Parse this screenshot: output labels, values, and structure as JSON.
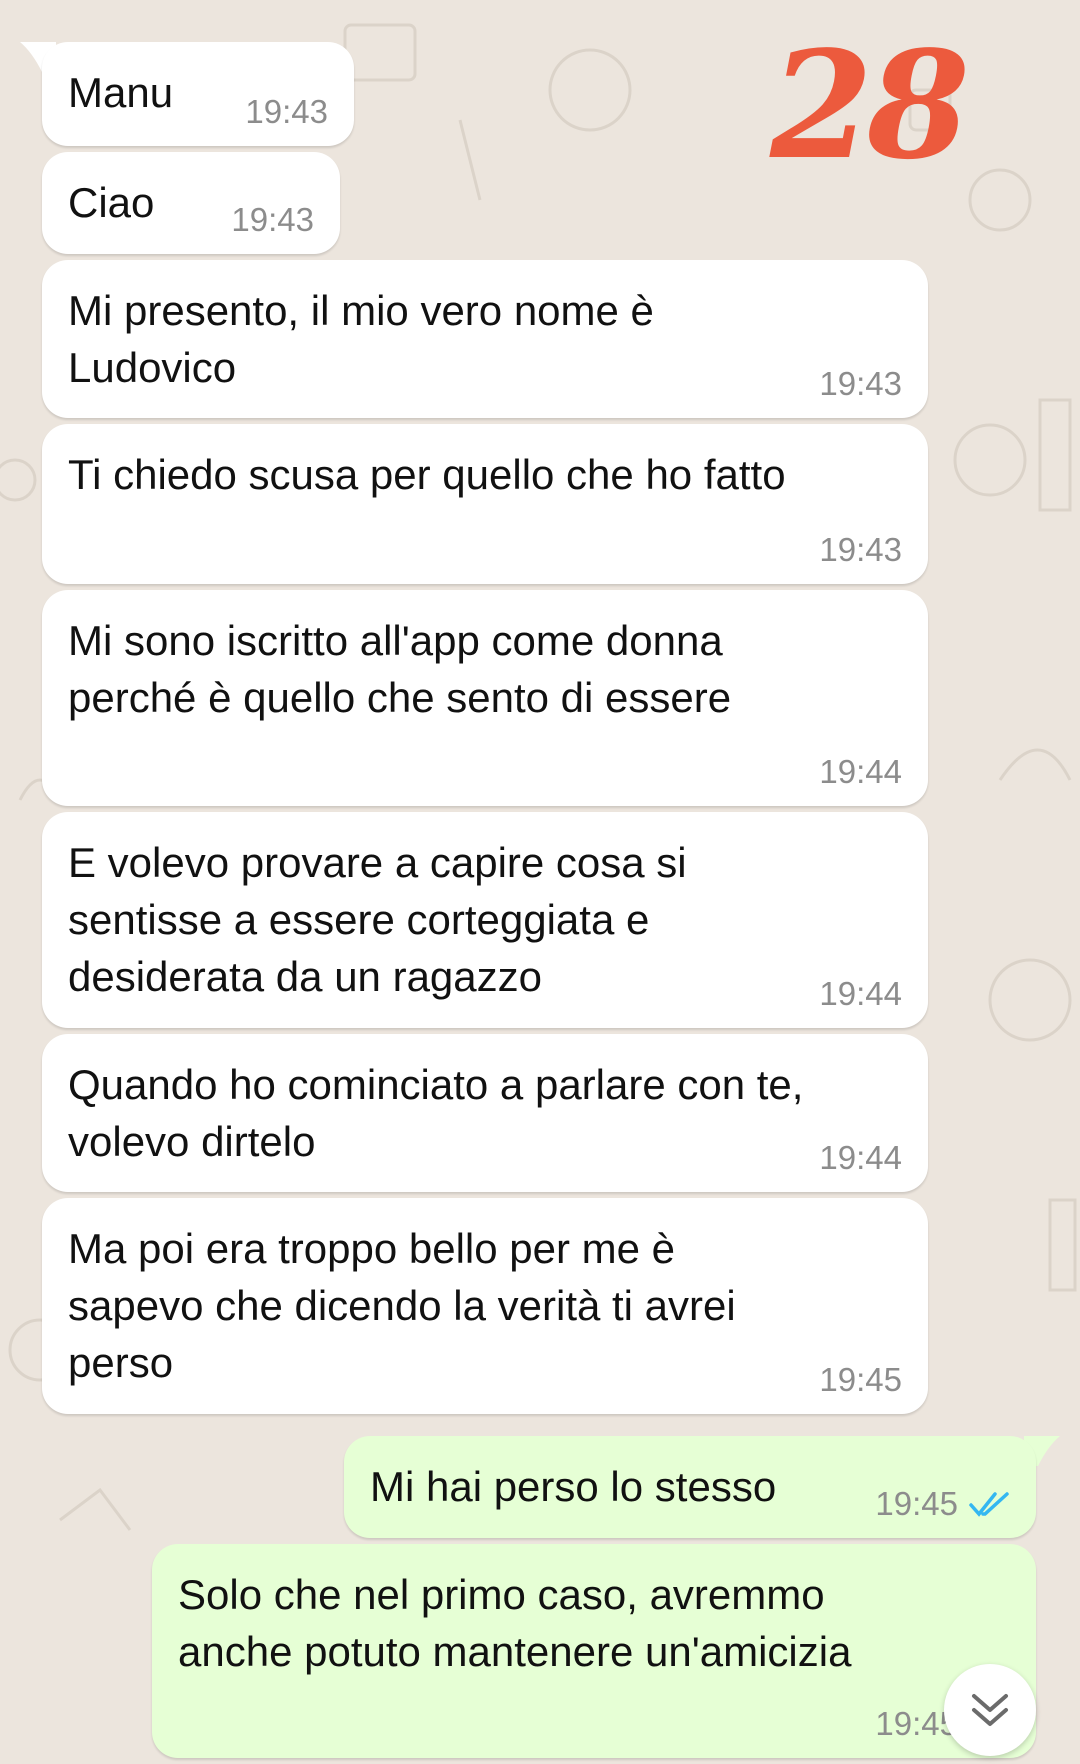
{
  "badge": {
    "text": "28",
    "color": "#ec5a3d"
  },
  "messages": [
    {
      "direction": "in",
      "text": "Manu",
      "time": "19:43"
    },
    {
      "direction": "in",
      "text": "Ciao",
      "time": "19:43"
    },
    {
      "direction": "in",
      "text": "Mi presento, il mio vero nome è\nLudovico",
      "time": "19:43"
    },
    {
      "direction": "in",
      "text": "Ti chiedo scusa per quello che ho fatto",
      "time": "19:43"
    },
    {
      "direction": "in",
      "text": "Mi sono iscritto all'app come donna\nperché è quello che sento di essere",
      "time": "19:44"
    },
    {
      "direction": "in",
      "text": "E volevo provare a capire cosa si\nsentisse a essere corteggiata e\ndesiderata da un ragazzo",
      "time": "19:44"
    },
    {
      "direction": "in",
      "text": "Quando ho cominciato a parlare con te,\nvolevo dirtelo",
      "time": "19:44"
    },
    {
      "direction": "in",
      "text": "Ma poi era troppo bello per me è\nsapevo che dicendo la verità ti avrei\nperso",
      "time": "19:45"
    },
    {
      "direction": "out",
      "text": "Mi hai perso lo stesso",
      "time": "19:45",
      "status": "read"
    },
    {
      "direction": "out",
      "text": "Solo che nel primo caso, avremmo\nanche potuto mantenere un'amicizia",
      "time": "19:45",
      "status": "read"
    }
  ],
  "icons": {
    "read_ticks": "double-check-icon",
    "scroll_down": "chevron-double-down-icon"
  },
  "colors": {
    "incoming_bubble": "#ffffff",
    "outgoing_bubble": "#e6ffd5",
    "read_tick": "#34b7f1",
    "background": "#ece5dd"
  }
}
